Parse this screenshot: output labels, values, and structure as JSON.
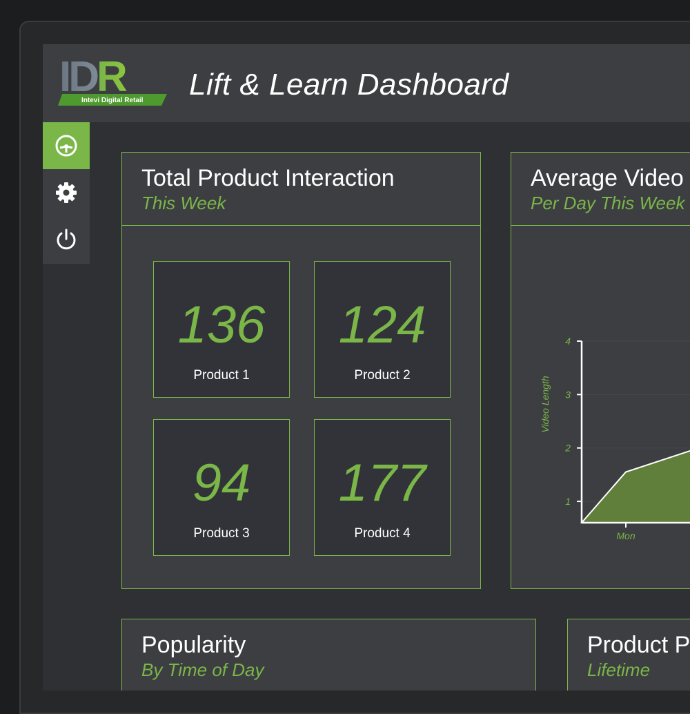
{
  "header": {
    "logo_text": "IDR",
    "logo_tagline": "Intevi Digital Retail",
    "title": "Lift & Learn Dashboard"
  },
  "sidebar": {
    "items": [
      {
        "name": "dashboard",
        "icon": "dashboard-gauge-icon",
        "active": true
      },
      {
        "name": "settings",
        "icon": "gear-icon",
        "active": false
      },
      {
        "name": "power",
        "icon": "power-icon",
        "active": false
      }
    ]
  },
  "cards": {
    "interaction": {
      "title": "Total Product Interaction",
      "subtitle": "This Week",
      "tiles": [
        {
          "value": "136",
          "label": "Product 1"
        },
        {
          "value": "124",
          "label": "Product 2"
        },
        {
          "value": "94",
          "label": "Product 3"
        },
        {
          "value": "177",
          "label": "Product 4"
        }
      ]
    },
    "video": {
      "title": "Average Video",
      "subtitle": "Per Day This Week"
    },
    "popularity": {
      "title": "Popularity",
      "subtitle": "By Time of Day"
    },
    "product": {
      "title": "Product P",
      "subtitle": "Lifetime"
    }
  },
  "chart_data": {
    "type": "area",
    "categories": [
      "Mon"
    ],
    "values": [
      1.55
    ],
    "ylabel": "Video Length",
    "ylim": [
      0.6,
      4
    ],
    "yticks": [
      "1",
      "2",
      "3",
      "4"
    ],
    "grid": true,
    "color": "#5f7f3a"
  },
  "colors": {
    "accent": "#7ab648",
    "panel": "#3d3e42",
    "background": "#2f3034"
  }
}
